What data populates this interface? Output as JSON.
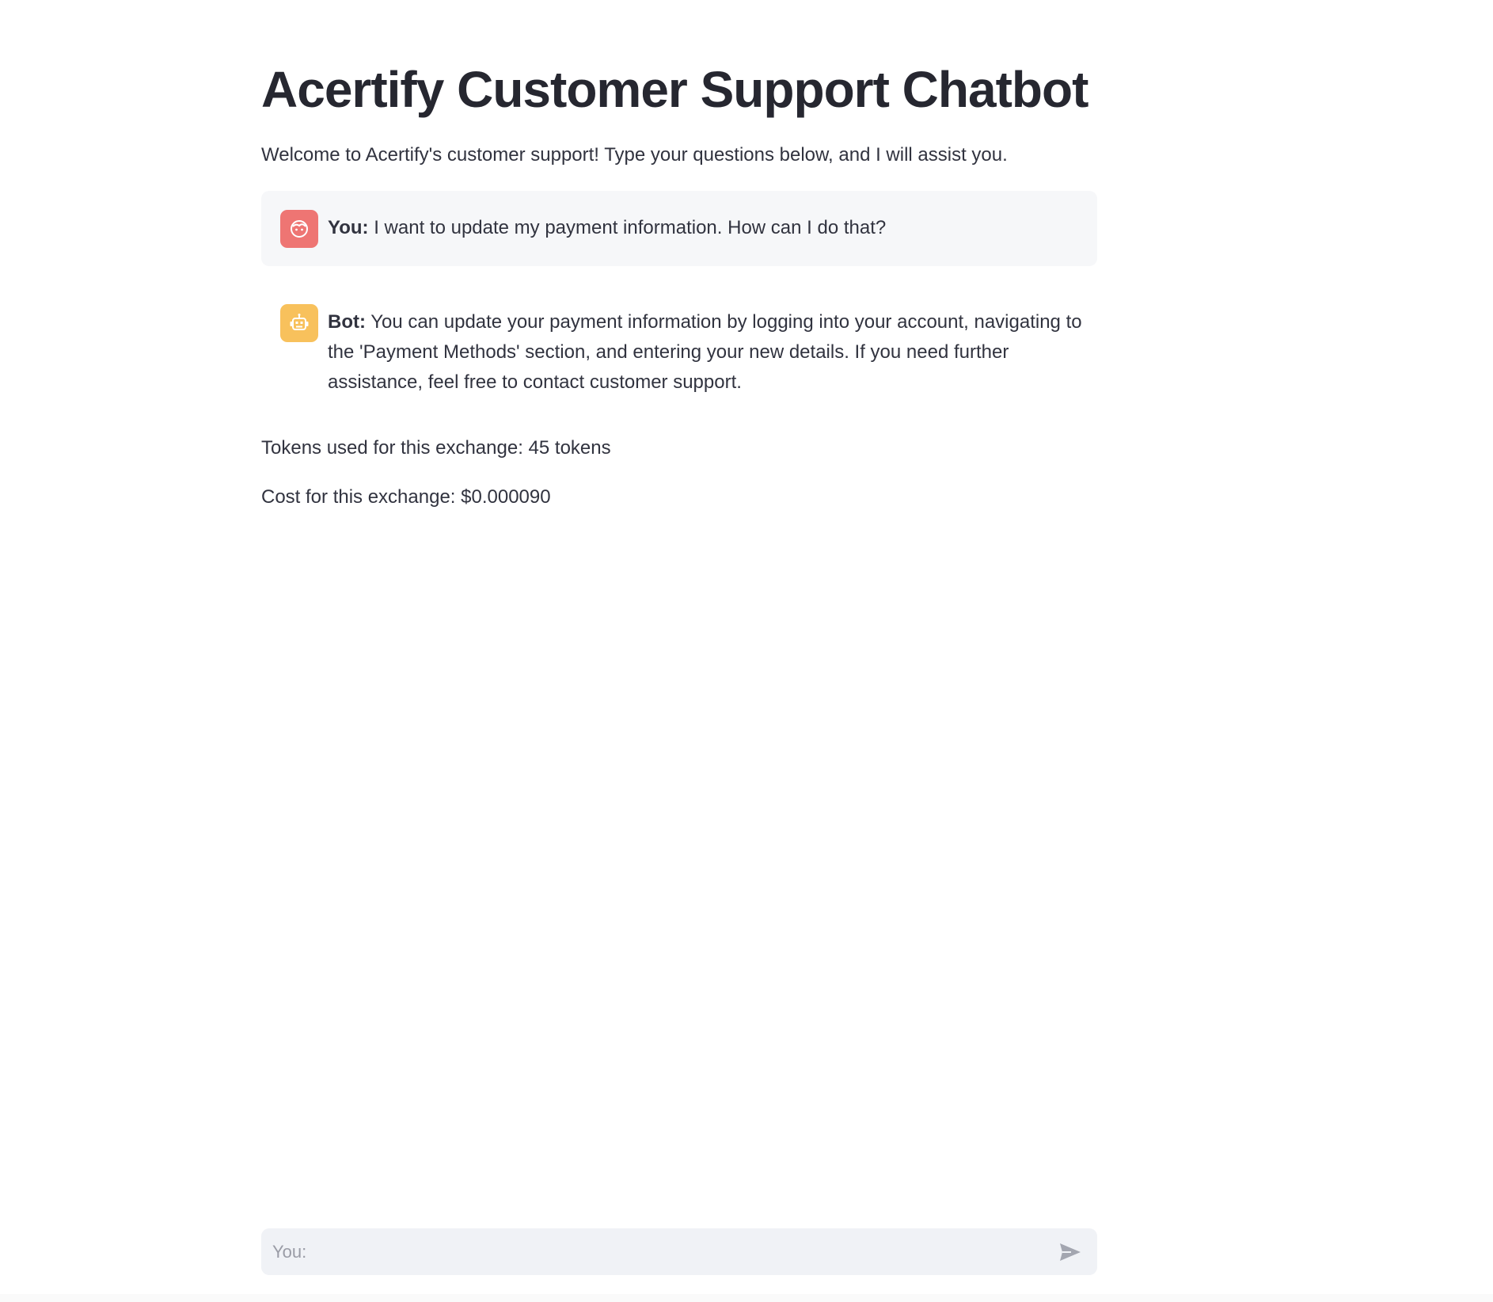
{
  "page": {
    "title": "Acertify Customer Support Chatbot",
    "intro": "Welcome to Acertify's customer support! Type your questions below, and I will assist you."
  },
  "messages": [
    {
      "role": "user",
      "speaker": "You:",
      "text": "I want to update my payment information. How can I do that?",
      "avatar_icon": "smiley-face-icon",
      "avatar_color": "#ee7573"
    },
    {
      "role": "bot",
      "speaker": "Bot:",
      "text": "You can update your payment information by logging into your account, navigating to the 'Payment Methods' section, and entering your new details. If you need further assistance, feel free to contact customer support.",
      "avatar_icon": "robot-icon",
      "avatar_color": "#f8c15c"
    }
  ],
  "stats": {
    "tokens": "Tokens used for this exchange: 45 tokens",
    "cost": "Cost for this exchange: $0.000090"
  },
  "chat_input": {
    "placeholder": "You:",
    "value": "",
    "send_icon": "send-icon"
  }
}
